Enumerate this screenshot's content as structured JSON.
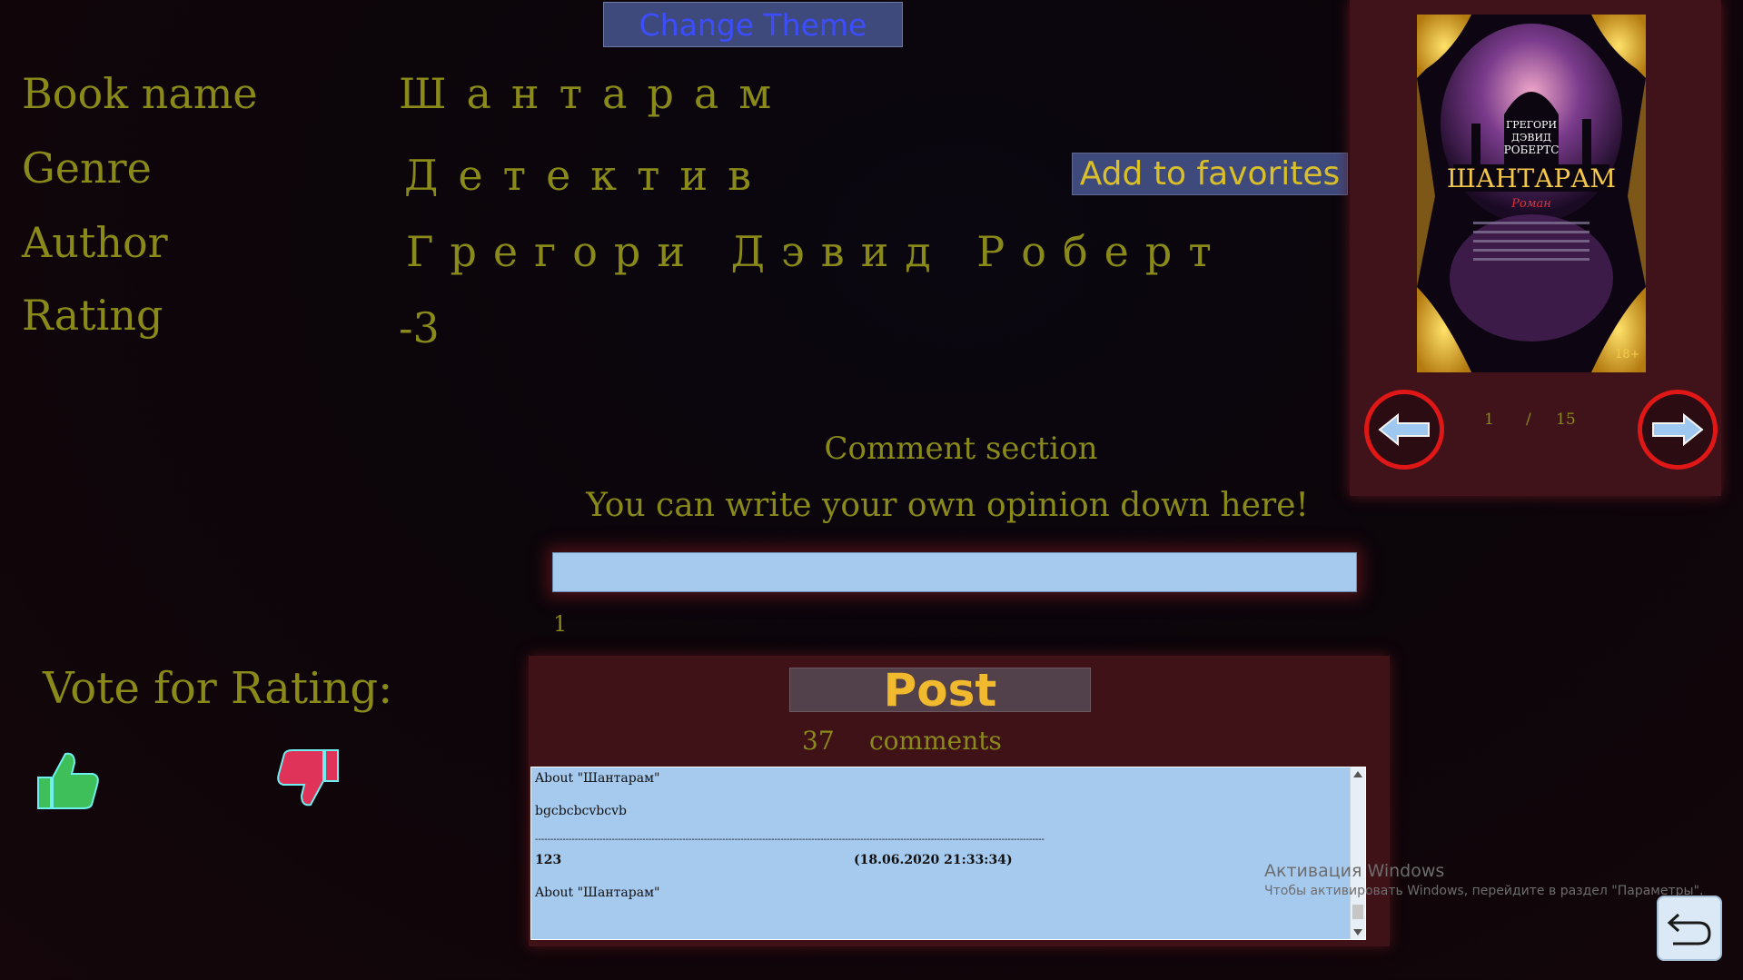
{
  "header": {
    "change_theme_label": "Change Theme"
  },
  "book": {
    "labels": {
      "name": "Book name",
      "genre": "Genre",
      "author": "Author",
      "rating": "Rating"
    },
    "name": "Шантарам",
    "genre": "Детектив",
    "author": "Грегори Дэвид Роберт",
    "rating": "-3"
  },
  "favorites_label": "Add to favorites",
  "cover": {
    "author_line1": "ГРЕГОРИ",
    "author_line2": "ДЭВИД",
    "author_line3": "РОБЕРТС",
    "title": "ШАНТАРАМ",
    "subtitle": "Роман",
    "age": "18+"
  },
  "pager": {
    "current": "1",
    "separator": "/",
    "total": "15"
  },
  "comments": {
    "section_title": "Comment section",
    "hint": "You can write your own opinion down here!",
    "input_value": "",
    "char_count": "1",
    "post_label": "Post",
    "count": "37",
    "count_label": "comments",
    "entries": [
      {
        "about": "About \"Шантарам\"",
        "text": "bgcbcbcvbcvb",
        "separator": "----------------------------------------------------------------------------------------------------------------------------------------------------------------------"
      },
      {
        "user": "123",
        "date": "(18.06.2020 21:33:34)",
        "about": "About \"Шантарам\""
      }
    ]
  },
  "vote": {
    "title": "Vote for Rating:"
  },
  "watermark": {
    "line1": "Активация Windows",
    "line2": "Чтобы активировать Windows, перейдите в раздел \"Параметры\"."
  },
  "colors": {
    "olive": "#8a8a1a",
    "panel": "#40131a",
    "input_bg": "#a6c9ee",
    "button_bg": "#3f4a7c",
    "nav_ring": "#e01717"
  }
}
